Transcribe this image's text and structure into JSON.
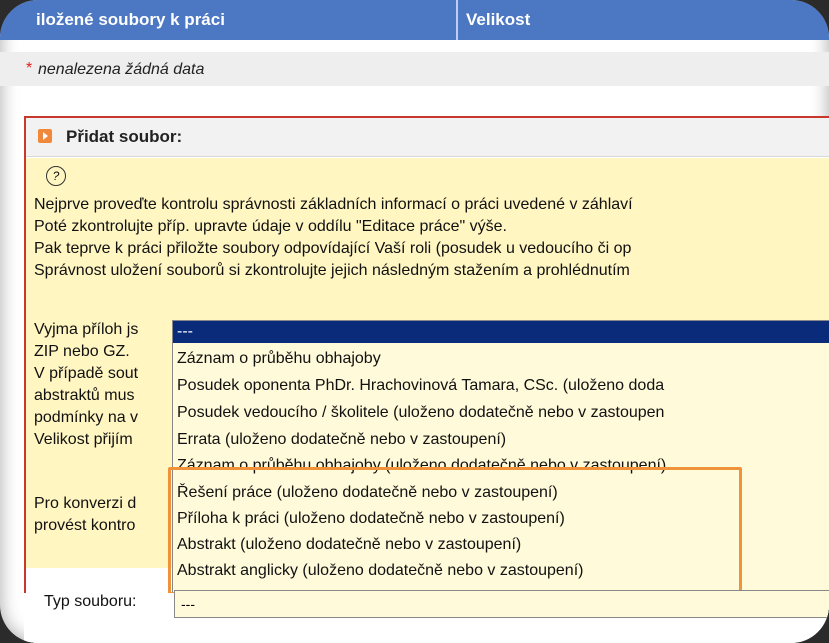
{
  "table_header": {
    "col1": "iložené soubory k práci",
    "col2": "Velikost"
  },
  "no_data": {
    "mark": "*",
    "text": "nenalezena žádná data"
  },
  "panel": {
    "title": "Přidat soubor:",
    "help_mark": "?"
  },
  "help_lines": [
    "Nejprve proveďte kontrolu správnosti základních informací o práci uvedené v záhlaví",
    "Poté zkontrolujte příp. upravte údaje v oddílu \"Editace práce\" výše.",
    "Pak teprve k práci přiložte soubory odpovídající Vaší roli (posudek u vedoucího či op",
    "Správnost uložení souborů si zkontrolujte jejich následným stažením a prohlédnutím"
  ],
  "help_lines2": [
    "Vyjma příloh js",
    "ZIP nebo GZ.",
    "V případě sout",
    "abstraktů mus",
    "podmínky na v",
    "Velikost přijím",
    "",
    "Pro konverzi d",
    "provést kontro"
  ],
  "listbox": {
    "options": [
      "---",
      "Záznam o průběhu obhajoby",
      "Posudek oponenta PhDr. Hrachovinová Tamara, CSc. (uloženo doda",
      "Posudek vedoucího / školitele (uloženo dodatečně nebo v zastoupen",
      "Errata (uloženo dodatečně nebo v zastoupení)",
      "Záznam o průběhu obhajoby (uloženo dodatečně nebo v zastoupení)",
      "Řešení práce (uloženo dodatečně nebo v zastoupení)",
      "Příloha k práci (uloženo dodatečně nebo v zastoupení)",
      "Abstrakt (uloženo dodatečně nebo v zastoupení)",
      "Abstrakt anglicky (uloženo dodatečně nebo v zastoupení)"
    ]
  },
  "file_type": {
    "label": "Typ souboru:",
    "value": "---"
  },
  "colors": {
    "header": "#4c77c3",
    "panel_border": "#c9392b",
    "help_bg": "#fff6c2",
    "selected": "#0a2a7a",
    "highlight": "#f0923a"
  }
}
